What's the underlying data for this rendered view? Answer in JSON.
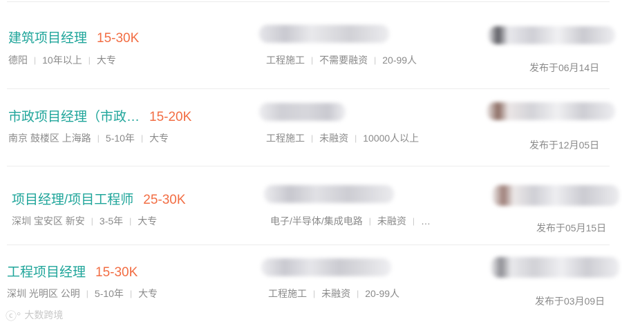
{
  "jobs": [
    {
      "title": "建筑项目经理",
      "salary": "15-30K",
      "location": "德阳",
      "experience": "10年以上",
      "education": "大专",
      "industry": "工程施工",
      "financing": "不需要融资",
      "size": "20-99人",
      "published": "发布于06月14日"
    },
    {
      "title": "市政项目经理（市政…",
      "salary": "15-20K",
      "location": "南京 鼓楼区 上海路",
      "experience": "5-10年",
      "education": "大专",
      "industry": "工程施工",
      "financing": "未融资",
      "size": "10000人以上",
      "published": "发布于12月05日"
    },
    {
      "title": "项目经理/项目工程师",
      "salary": "25-30K",
      "location": "深圳 宝安区 新安",
      "experience": "3-5年",
      "education": "大专",
      "industry": "电子/半导体/集成电路",
      "financing": "未融资",
      "size": "…",
      "published": "发布于05月15日"
    },
    {
      "title": "工程项目经理",
      "salary": "15-30K",
      "location": "深圳 光明区 公明",
      "experience": "5-10年",
      "education": "大专",
      "industry": "工程施工",
      "financing": "未融资",
      "size": "20-99人",
      "published": "发布于03月09日"
    }
  ],
  "watermark": {
    "text": "大数跨境",
    "icon": "brand-logo-icon"
  },
  "colors": {
    "title": "#1fa59a",
    "salary": "#f26d43",
    "meta": "#8a8a8a"
  }
}
